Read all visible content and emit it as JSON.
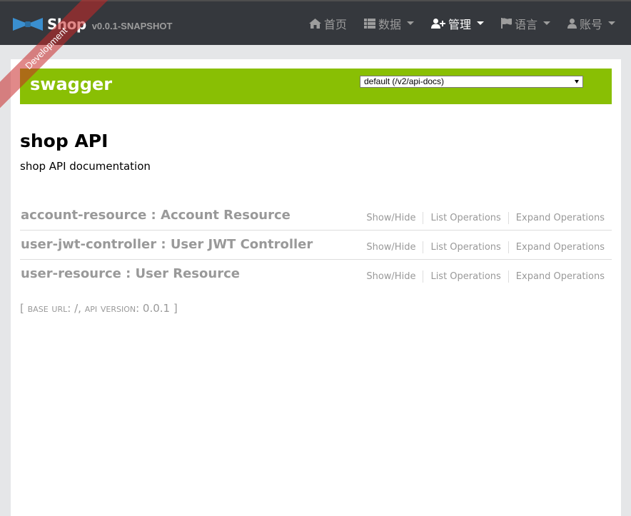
{
  "navbar": {
    "brand_name": "Shop",
    "version": "v0.0.1-SNAPSHOT",
    "items": [
      {
        "label": "首页",
        "icon": "home-icon",
        "dropdown": false
      },
      {
        "label": "数据",
        "icon": "table-list-icon",
        "dropdown": true
      },
      {
        "label": "管理",
        "icon": "user-plus-icon",
        "dropdown": true,
        "active": true
      },
      {
        "label": "语言",
        "icon": "flag-icon",
        "dropdown": true
      },
      {
        "label": "账号",
        "icon": "user-icon",
        "dropdown": true
      }
    ]
  },
  "ribbon": {
    "text": "Development"
  },
  "swagger": {
    "logo": "swagger",
    "spec_selected": "default (/v2/api-docs)",
    "header_color": "#89bf04"
  },
  "api": {
    "title": "shop API",
    "description": "shop API documentation"
  },
  "resources": [
    {
      "name": "account-resource : Account Resource",
      "show_hide": "Show/Hide",
      "list_ops": "List Operations",
      "expand_ops": "Expand Operations"
    },
    {
      "name": "user-jwt-controller : User JWT Controller",
      "show_hide": "Show/Hide",
      "list_ops": "List Operations",
      "expand_ops": "Expand Operations"
    },
    {
      "name": "user-resource : User Resource",
      "show_hide": "Show/Hide",
      "list_ops": "List Operations",
      "expand_ops": "Expand Operations"
    }
  ],
  "footer": {
    "open_bracket": "[",
    "base_url_label": "base url",
    "base_url_value": "/",
    "api_version_label": "api version",
    "api_version_value": "0.0.1",
    "close_bracket": "]"
  }
}
